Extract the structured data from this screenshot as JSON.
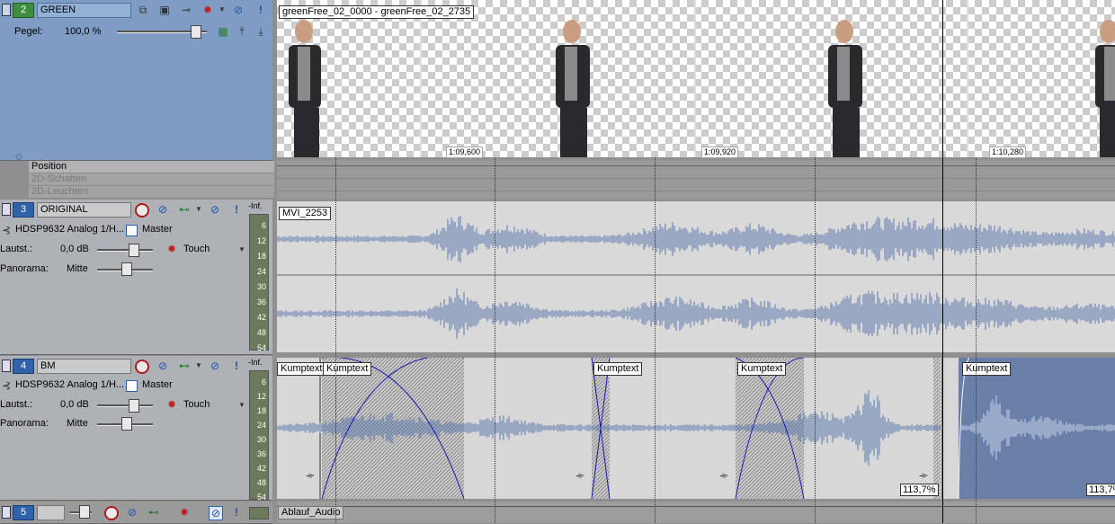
{
  "track_video": {
    "number": "2",
    "name": "GREEN",
    "level_label": "Pegel:",
    "level_value": "100,0 %",
    "envelopes": [
      "Position",
      "2D-Schatten",
      "2D-Leuchten"
    ],
    "clip_name": "greenFree_02_0000 - greenFree_02_2735",
    "timestamps": [
      "1:09,600",
      "1:09,920",
      "1:10,280"
    ]
  },
  "track_audio1": {
    "number": "3",
    "name": "ORIGINAL",
    "device": "HDSP9632 Analog 1/H...",
    "bus": "Master",
    "volume_label": "Lautst.:",
    "volume_value": "0,0 dB",
    "automation_mode": "Touch",
    "pan_label": "Panorama:",
    "pan_value": "Mitte",
    "clip_name": "MVI_2253"
  },
  "track_audio2": {
    "number": "4",
    "name": "BM",
    "device": "HDSP9632 Analog 1/H...",
    "bus": "Master",
    "volume_label": "Lautst.:",
    "volume_value": "0,0 dB",
    "automation_mode": "Touch",
    "pan_label": "Panorama:",
    "pan_value": "Mitte",
    "clip_names": [
      "Kumptext",
      "Kumptext",
      "Kumptext",
      "Kumptext",
      "Kumptext"
    ],
    "percentages": [
      "113,7%",
      "113,7%"
    ]
  },
  "track5": {
    "number": "5",
    "clip_name": "Ablauf_Audio"
  },
  "meter": {
    "head": "-Inf.",
    "scale": [
      "6",
      "12",
      "18",
      "24",
      "30",
      "36",
      "42",
      "48",
      "54"
    ]
  },
  "colors": {
    "video_header": "#7e9cc4",
    "audio_header": "#aeb1b5",
    "waveform": "#5a77ad",
    "track_number": "#2f62a8",
    "selected_clip": "#6a7fa8"
  },
  "icons": [
    "fx-icon",
    "compositing-icon",
    "track-motion-icon",
    "gear-icon",
    "mute-icon",
    "solo-icon",
    "record-arm-icon",
    "phase-invert-icon",
    "automation-icon",
    "arrow-up-icon",
    "arrow-down-icon"
  ]
}
